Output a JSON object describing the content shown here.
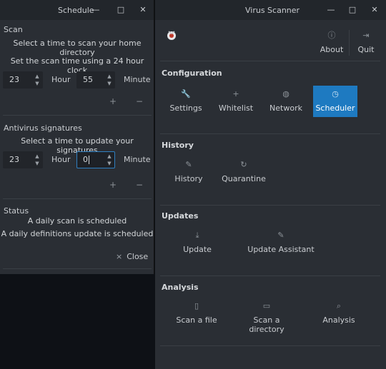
{
  "schedule_window": {
    "title": "Schedule",
    "scan": {
      "section_title": "Scan",
      "description": "Select a time to scan your home directory",
      "hint": "Set the scan time using a 24 hour clock",
      "hour_value": "23",
      "hour_label": "Hour",
      "minute_value": "55",
      "minute_label": "Minute"
    },
    "signatures": {
      "section_title": "Antivirus signatures",
      "description": "Select a time to update your signatures",
      "hour_value": "23",
      "hour_label": "Hour",
      "minute_value": "0",
      "minute_label": "Minute"
    },
    "status": {
      "section_title": "Status",
      "line1": "A daily scan is scheduled",
      "line2": "A daily definitions update is scheduled"
    },
    "close_label": "Close",
    "close_icon": "×",
    "plus_icon": "+",
    "minus_icon": "−"
  },
  "scanner_window": {
    "title": "Virus Scanner",
    "header": {
      "about_label": "About",
      "quit_label": "Quit"
    },
    "configuration": {
      "title": "Configuration",
      "items": [
        "Settings",
        "Whitelist",
        "Network",
        "Scheduler"
      ],
      "active": "Scheduler"
    },
    "history": {
      "title": "History",
      "items": [
        "History",
        "Quarantine"
      ]
    },
    "updates": {
      "title": "Updates",
      "items": [
        "Update",
        "Update Assistant"
      ]
    },
    "analysis": {
      "title": "Analysis",
      "items": [
        "Scan a file",
        "Scan a directory",
        "Analysis"
      ]
    }
  },
  "window_controls": {
    "minimize": "—",
    "maximize": "□",
    "close": "✕"
  },
  "colors": {
    "accent": "#1e7ac1",
    "window_bg": "#2a2e34",
    "titlebar_bg": "#22262b",
    "desktop_bg": "#0e1116"
  }
}
